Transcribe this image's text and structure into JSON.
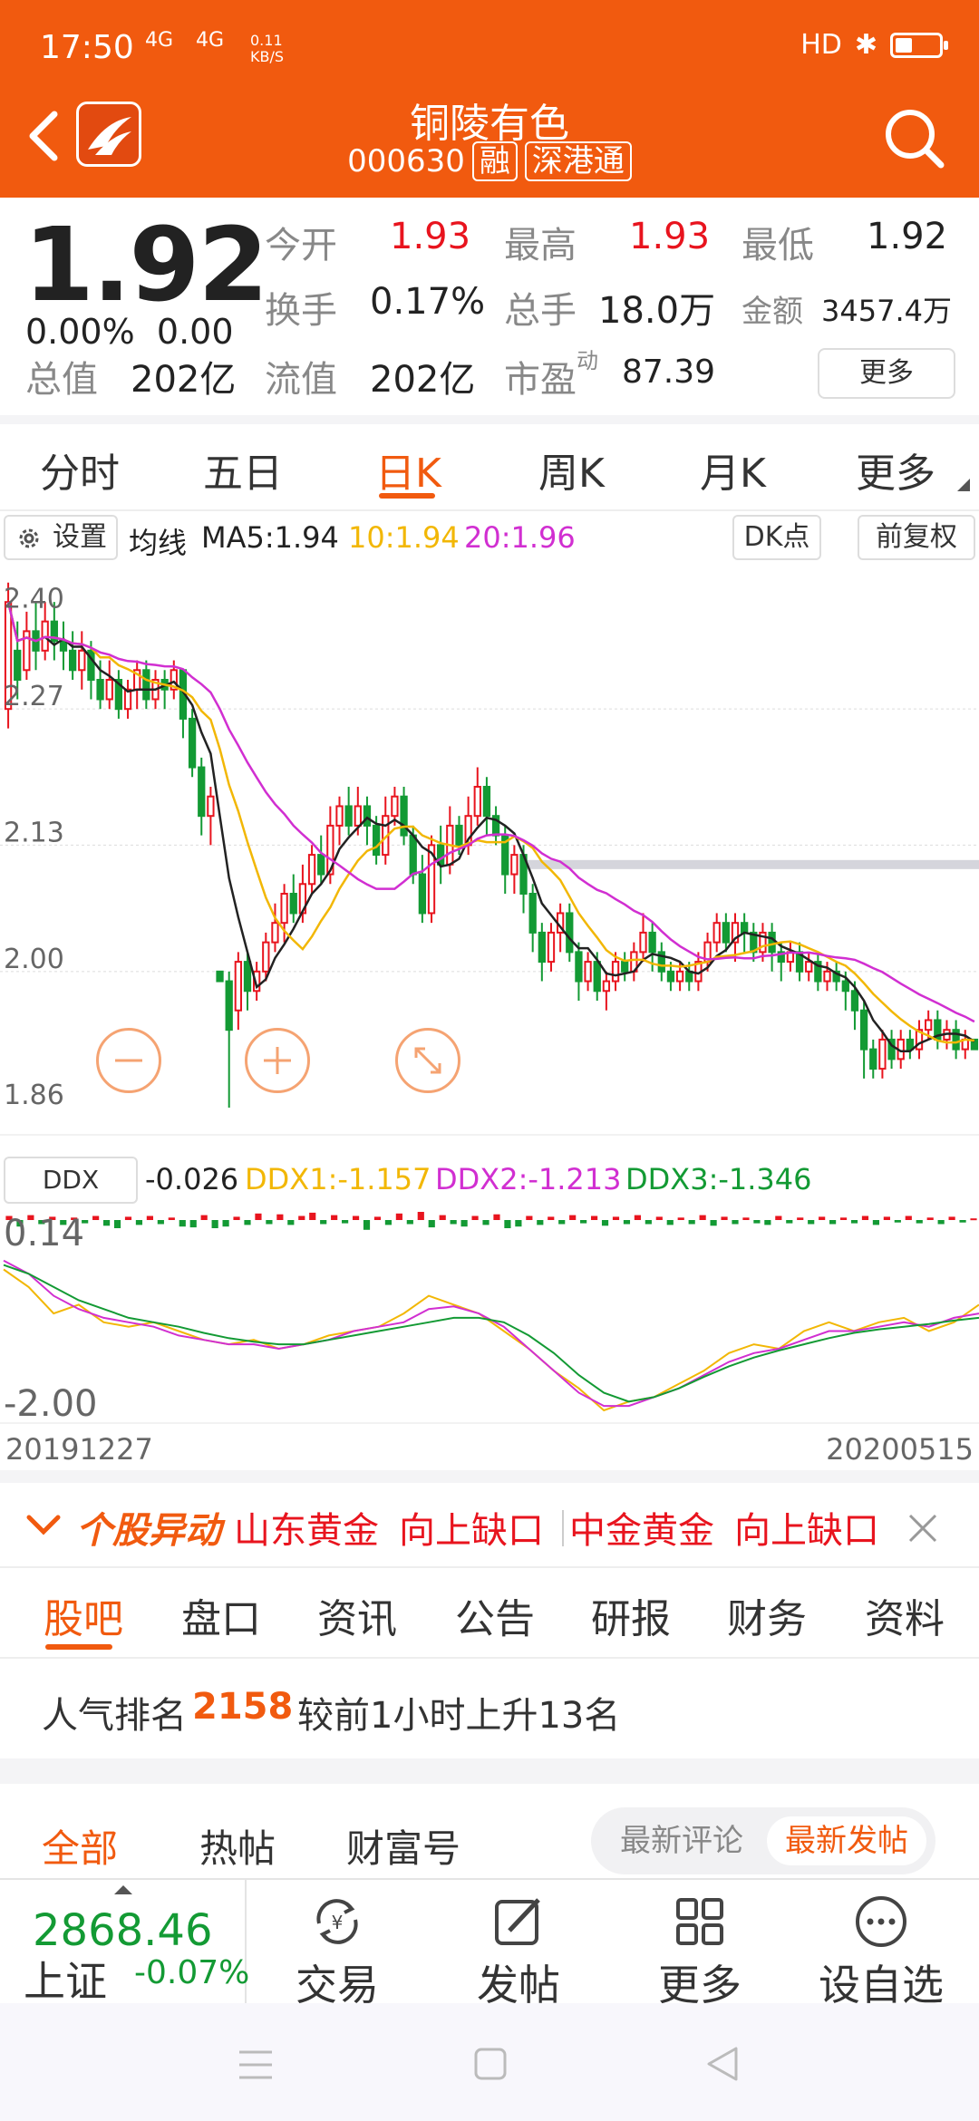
{
  "status_bar": {
    "time": "17:50",
    "signal1": "4G",
    "signal2": "4G",
    "net_speed_value": "0.11",
    "net_speed_unit": "KB/S",
    "right": "HD"
  },
  "header": {
    "stock_name": "铜陵有色",
    "stock_code": "000630",
    "tag1": "融",
    "tag2": "深港通"
  },
  "quote": {
    "price": "1.92",
    "change_pct": "0.00%",
    "change_amt": "0.00",
    "open_label": "今开",
    "open": "1.93",
    "high_label": "最高",
    "high": "1.93",
    "low_label": "最低",
    "low": "1.92",
    "turnover_label": "换手",
    "turnover": "0.17%",
    "volume_label": "总手",
    "volume": "18.0万",
    "amount_label": "金额",
    "amount": "3457.4万",
    "mcap_label": "总值",
    "mcap": "202亿",
    "float_label": "流值",
    "float": "202亿",
    "pe_label": "市盈",
    "pe_sup": "动",
    "pe": "87.39",
    "more": "更多"
  },
  "period_tabs": [
    "分时",
    "五日",
    "日K",
    "周K",
    "月K",
    "更多"
  ],
  "active_period": "日K",
  "chart_toolbar": {
    "settings": "设置",
    "ma_label": "均线",
    "ma5": "MA5:1.94",
    "ma10": "10:1.94",
    "ma20": "20:1.96",
    "dk": "DK点",
    "adjust": "前复权"
  },
  "colors": {
    "brand": "#f15a0f",
    "up": "#e8141e",
    "down": "#139a34",
    "ma5": "#222222",
    "ma10": "#f2b705",
    "ma20": "#d12fd1"
  },
  "ddx": {
    "label": "DDX",
    "value": "-0.026",
    "ddx1": "DDX1:-1.157",
    "ddx2": "DDX2:-1.213",
    "ddx3": "DDX3:-1.346"
  },
  "chart_data": [
    {
      "type": "candlestick",
      "y_ticks": [
        "2.40",
        "2.27",
        "2.13",
        "2.00",
        "1.86"
      ],
      "ylim": [
        1.86,
        2.41
      ],
      "x_start": "20191227",
      "x_end": "20200515",
      "candles": [
        [
          2.27,
          2.38,
          2.4,
          2.25
        ],
        [
          2.33,
          2.3,
          2.36,
          2.28
        ],
        [
          2.31,
          2.35,
          2.37,
          2.3
        ],
        [
          2.35,
          2.33,
          2.38,
          2.31
        ],
        [
          2.33,
          2.36,
          2.38,
          2.32
        ],
        [
          2.36,
          2.34,
          2.38,
          2.32
        ],
        [
          2.34,
          2.33,
          2.36,
          2.31
        ],
        [
          2.33,
          2.31,
          2.35,
          2.3
        ],
        [
          2.31,
          2.33,
          2.35,
          2.29
        ],
        [
          2.33,
          2.3,
          2.34,
          2.28
        ],
        [
          2.3,
          2.28,
          2.32,
          2.27
        ],
        [
          2.28,
          2.3,
          2.32,
          2.27
        ],
        [
          2.3,
          2.27,
          2.31,
          2.26
        ],
        [
          2.27,
          2.29,
          2.3,
          2.26
        ],
        [
          2.29,
          2.31,
          2.32,
          2.27
        ],
        [
          2.31,
          2.28,
          2.32,
          2.27
        ],
        [
          2.28,
          2.3,
          2.31,
          2.27
        ],
        [
          2.3,
          2.29,
          2.31,
          2.27
        ],
        [
          2.29,
          2.31,
          2.32,
          2.28
        ],
        [
          2.31,
          2.26,
          2.31,
          2.24
        ],
        [
          2.26,
          2.21,
          2.27,
          2.2
        ],
        [
          2.21,
          2.16,
          2.22,
          2.14
        ],
        [
          2.16,
          2.18,
          2.19,
          2.13
        ],
        [
          2.0,
          1.99,
          2.0,
          1.99
        ],
        [
          1.99,
          1.94,
          2.0,
          1.86
        ],
        [
          1.96,
          2.01,
          2.02,
          1.94
        ],
        [
          2.01,
          1.98,
          2.02,
          1.96
        ],
        [
          1.98,
          2.0,
          2.01,
          1.97
        ],
        [
          2.0,
          2.03,
          2.04,
          1.99
        ],
        [
          2.03,
          2.05,
          2.07,
          2.02
        ],
        [
          2.05,
          2.08,
          2.09,
          2.03
        ],
        [
          2.08,
          2.06,
          2.1,
          2.05
        ],
        [
          2.06,
          2.09,
          2.11,
          2.05
        ],
        [
          2.09,
          2.12,
          2.13,
          2.08
        ],
        [
          2.12,
          2.1,
          2.14,
          2.09
        ],
        [
          2.1,
          2.15,
          2.17,
          2.09
        ],
        [
          2.15,
          2.17,
          2.18,
          2.13
        ],
        [
          2.17,
          2.15,
          2.19,
          2.14
        ],
        [
          2.15,
          2.17,
          2.19,
          2.14
        ],
        [
          2.17,
          2.15,
          2.18,
          2.13
        ],
        [
          2.15,
          2.12,
          2.16,
          2.11
        ],
        [
          2.12,
          2.16,
          2.18,
          2.11
        ],
        [
          2.16,
          2.18,
          2.19,
          2.15
        ],
        [
          2.18,
          2.14,
          2.19,
          2.13
        ],
        [
          2.14,
          2.1,
          2.15,
          2.09
        ],
        [
          2.1,
          2.06,
          2.12,
          2.05
        ],
        [
          2.06,
          2.13,
          2.14,
          2.05
        ],
        [
          2.13,
          2.11,
          2.15,
          2.09
        ],
        [
          2.11,
          2.15,
          2.17,
          2.1
        ],
        [
          2.15,
          2.13,
          2.16,
          2.12
        ],
        [
          2.13,
          2.16,
          2.18,
          2.12
        ],
        [
          2.16,
          2.19,
          2.21,
          2.15
        ],
        [
          2.19,
          2.16,
          2.2,
          2.14
        ],
        [
          2.16,
          2.14,
          2.17,
          2.13
        ],
        [
          2.14,
          2.1,
          2.15,
          2.08
        ],
        [
          2.1,
          2.12,
          2.13,
          2.08
        ],
        [
          2.12,
          2.08,
          2.13,
          2.06
        ],
        [
          2.08,
          2.04,
          2.09,
          2.02
        ],
        [
          2.04,
          2.01,
          2.05,
          1.99
        ],
        [
          2.01,
          2.04,
          2.05,
          2.0
        ],
        [
          2.04,
          2.06,
          2.07,
          2.02
        ],
        [
          2.06,
          2.02,
          2.07,
          2.01
        ],
        [
          2.02,
          1.99,
          2.03,
          1.97
        ],
        [
          1.99,
          2.01,
          2.02,
          1.98
        ],
        [
          2.01,
          1.98,
          2.02,
          1.97
        ],
        [
          1.98,
          1.99,
          2.0,
          1.96
        ],
        [
          1.99,
          2.01,
          2.02,
          1.98
        ],
        [
          2.01,
          2.0,
          2.02,
          1.99
        ],
        [
          2.0,
          2.02,
          2.03,
          1.99
        ],
        [
          2.02,
          2.04,
          2.06,
          2.01
        ],
        [
          2.04,
          2.02,
          2.05,
          2.0
        ],
        [
          2.02,
          2.0,
          2.03,
          1.99
        ],
        [
          2.0,
          1.99,
          2.01,
          1.98
        ],
        [
          1.99,
          2.0,
          2.01,
          1.98
        ],
        [
          2.0,
          1.99,
          2.01,
          1.98
        ],
        [
          1.99,
          2.01,
          2.02,
          1.98
        ],
        [
          2.01,
          2.03,
          2.04,
          2.0
        ],
        [
          2.03,
          2.05,
          2.06,
          2.02
        ],
        [
          2.05,
          2.03,
          2.06,
          2.02
        ],
        [
          2.03,
          2.05,
          2.06,
          2.01
        ],
        [
          2.05,
          2.04,
          2.06,
          2.02
        ],
        [
          2.04,
          2.02,
          2.05,
          2.01
        ],
        [
          2.02,
          2.04,
          2.05,
          2.01
        ],
        [
          2.04,
          2.02,
          2.05,
          2.0
        ],
        [
          2.02,
          2.01,
          2.03,
          1.99
        ],
        [
          2.01,
          2.02,
          2.03,
          2.0
        ],
        [
          2.02,
          2.0,
          2.03,
          1.99
        ],
        [
          2.0,
          2.01,
          2.02,
          1.99
        ],
        [
          2.01,
          1.99,
          2.02,
          1.98
        ],
        [
          1.99,
          2.0,
          2.01,
          1.98
        ],
        [
          2.0,
          1.99,
          2.01,
          1.98
        ],
        [
          1.99,
          1.98,
          2.0,
          1.96
        ],
        [
          1.98,
          1.96,
          1.99,
          1.94
        ],
        [
          1.96,
          1.92,
          1.97,
          1.89
        ],
        [
          1.92,
          1.9,
          1.93,
          1.89
        ],
        [
          1.9,
          1.93,
          1.94,
          1.89
        ],
        [
          1.93,
          1.91,
          1.94,
          1.9
        ],
        [
          1.91,
          1.93,
          1.94,
          1.9
        ],
        [
          1.93,
          1.92,
          1.94,
          1.91
        ],
        [
          1.92,
          1.94,
          1.95,
          1.91
        ],
        [
          1.94,
          1.95,
          1.96,
          1.93
        ],
        [
          1.95,
          1.93,
          1.96,
          1.92
        ],
        [
          1.93,
          1.94,
          1.95,
          1.92
        ],
        [
          1.94,
          1.92,
          1.95,
          1.91
        ],
        [
          1.92,
          1.93,
          1.94,
          1.91
        ],
        [
          1.93,
          1.92,
          1.93,
          1.92
        ]
      ]
    },
    {
      "type": "bar+line",
      "y_ticks": [
        "0.14",
        "-2.00"
      ],
      "ylim": [
        -2.0,
        0.14
      ],
      "bars": [
        0.05,
        -0.08,
        0.06,
        -0.05,
        0.04,
        -0.06,
        0.03,
        -0.04,
        0.05,
        -0.07,
        -0.1,
        0.04,
        -0.06,
        0.05,
        -0.05,
        0.03,
        -0.08,
        -0.09,
        0.06,
        -0.1,
        -0.08,
        0.04,
        -0.06,
        0.08,
        -0.05,
        0.07,
        -0.06,
        0.05,
        0.09,
        -0.05,
        0.06,
        -0.04,
        0.05,
        -0.12,
        0.04,
        -0.06,
        0.08,
        -0.05,
        0.1,
        -0.09,
        0.06,
        -0.05,
        -0.08,
        0.05,
        -0.06,
        0.07,
        -0.1,
        -0.08,
        0.05,
        -0.06,
        0.04,
        -0.05,
        0.06,
        -0.04,
        0.05,
        -0.07,
        0.04,
        -0.05,
        0.06,
        -0.05,
        0.04,
        -0.06,
        0.03,
        -0.05,
        0.06,
        -0.07,
        0.04,
        -0.05,
        0.03,
        -0.04,
        -0.06,
        0.05,
        -0.04,
        0.03,
        -0.05,
        0.04,
        -0.05,
        0.03,
        -0.04,
        0.05,
        -0.06,
        0.04,
        -0.03,
        0.05,
        -0.04,
        0.03,
        -0.05,
        0.04,
        -0.03,
        0.02
      ],
      "ddx1": [
        -0.4,
        -0.6,
        -0.9,
        -0.8,
        -1.0,
        -1.05,
        -1.0,
        -1.1,
        -1.2,
        -1.25,
        -1.2,
        -1.3,
        -1.25,
        -1.15,
        -1.1,
        -1.05,
        -0.9,
        -0.7,
        -0.8,
        -0.9,
        -1.1,
        -1.3,
        -1.55,
        -1.75,
        -2.0,
        -1.9,
        -1.85,
        -1.7,
        -1.55,
        -1.35,
        -1.25,
        -1.3,
        -1.1,
        -1.0,
        -1.1,
        -1.0,
        -0.95,
        -1.1,
        -1.0,
        -0.8
      ],
      "ddx2": [
        -0.3,
        -0.45,
        -0.7,
        -0.85,
        -0.95,
        -1.0,
        -1.05,
        -1.15,
        -1.2,
        -1.25,
        -1.25,
        -1.3,
        -1.25,
        -1.2,
        -1.1,
        -1.05,
        -1.0,
        -0.85,
        -0.82,
        -0.9,
        -1.05,
        -1.3,
        -1.55,
        -1.8,
        -1.95,
        -1.95,
        -1.85,
        -1.75,
        -1.6,
        -1.45,
        -1.35,
        -1.3,
        -1.2,
        -1.1,
        -1.1,
        -1.05,
        -1.0,
        -1.05,
        -0.95,
        -0.9
      ],
      "ddx3": [
        -0.35,
        -0.45,
        -0.6,
        -0.75,
        -0.85,
        -0.95,
        -1.0,
        -1.05,
        -1.12,
        -1.18,
        -1.22,
        -1.25,
        -1.25,
        -1.2,
        -1.15,
        -1.1,
        -1.05,
        -1.0,
        -0.95,
        -0.95,
        -1.0,
        -1.15,
        -1.35,
        -1.6,
        -1.8,
        -1.9,
        -1.85,
        -1.75,
        -1.62,
        -1.5,
        -1.4,
        -1.32,
        -1.25,
        -1.18,
        -1.12,
        -1.08,
        -1.05,
        -1.02,
        -0.98,
        -0.95
      ]
    }
  ],
  "chart_dates": {
    "start": "20191227",
    "end": "20200515"
  },
  "alert": {
    "title": "个股异动",
    "items": [
      "山东黄金",
      "向上缺口",
      "中金黄金",
      "向上缺口"
    ]
  },
  "community_tabs": [
    "股吧",
    "盘口",
    "资讯",
    "公告",
    "研报",
    "财务",
    "资料"
  ],
  "rank": {
    "label": "人气排名",
    "value": "2158",
    "desc": "较前1小时上升13名"
  },
  "feed_tabs": [
    "全部",
    "热帖",
    "财富号"
  ],
  "sort": [
    "最新评论",
    "最新发帖"
  ],
  "bottom_bar": {
    "index_value": "2868.46",
    "index_name": "上证",
    "index_change": "-0.07%",
    "buttons": [
      "交易",
      "发帖",
      "更多",
      "设自选"
    ]
  }
}
